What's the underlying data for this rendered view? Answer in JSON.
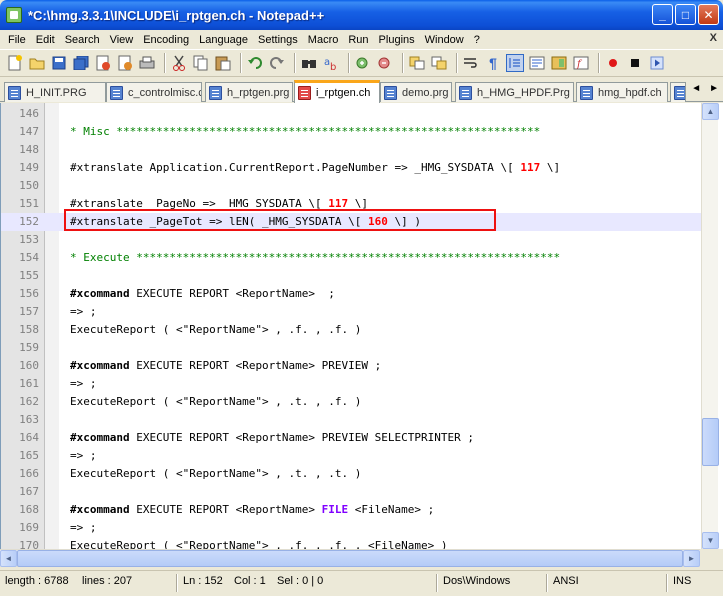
{
  "window": {
    "title": "*C:\\hmg.3.3.1\\INCLUDE\\i_rptgen.ch - Notepad++",
    "minimize_glyph": "_",
    "maximize_glyph": "□",
    "close_glyph": "✕"
  },
  "menu": {
    "items": [
      "File",
      "Edit",
      "Search",
      "View",
      "Encoding",
      "Language",
      "Settings",
      "Macro",
      "Run",
      "Plugins",
      "Window",
      "?"
    ],
    "close_glyph": "X"
  },
  "toolbar": {
    "icons": [
      "new-file-icon",
      "open-file-icon",
      "save-icon",
      "save-all-icon",
      "close-icon",
      "close-all-icon",
      "print-icon",
      "cut-icon",
      "copy-icon",
      "paste-icon",
      "undo-icon",
      "redo-icon",
      "find-icon",
      "replace-icon",
      "zoom-in-icon",
      "zoom-out-icon",
      "sync-v-icon",
      "sync-h-icon",
      "word-wrap-icon",
      "show-all-chars-icon",
      "indent-guide-icon",
      "user-lang-icon",
      "doc-map-icon",
      "function-list-icon",
      "record-macro-icon",
      "stop-macro-icon",
      "play-macro-icon"
    ]
  },
  "tabs": [
    {
      "label": "H_INIT.PRG",
      "active": false,
      "modified": false
    },
    {
      "label": "c_controlmisc.c",
      "active": false,
      "modified": false
    },
    {
      "label": "h_rptgen.prg",
      "active": false,
      "modified": false
    },
    {
      "label": "i_rptgen.ch",
      "active": true,
      "modified": true
    },
    {
      "label": "demo.prg",
      "active": false,
      "modified": false
    },
    {
      "label": "h_HMG_HPDF.Prg",
      "active": false,
      "modified": false
    },
    {
      "label": "hmg_hpdf.ch",
      "active": false,
      "modified": false
    }
  ],
  "tab_arrows": {
    "left": "◄",
    "right": "►"
  },
  "editor": {
    "current_line": 152,
    "lines": [
      {
        "n": "146",
        "segs": []
      },
      {
        "n": "147",
        "segs": [
          {
            "t": "* Misc ****************************************************************",
            "c": "comment"
          }
        ]
      },
      {
        "n": "148",
        "segs": []
      },
      {
        "n": "149",
        "segs": [
          {
            "t": "#xtranslate Application.CurrentReport.PageNumber => _HMG_SYSDATA \\[ ",
            "c": "normal"
          },
          {
            "t": "117",
            "c": "num"
          },
          {
            "t": " \\]",
            "c": "normal"
          }
        ]
      },
      {
        "n": "150",
        "segs": []
      },
      {
        "n": "151",
        "segs": [
          {
            "t": "#xtranslate  PageNo =>  HMG SYSDATA \\[ ",
            "c": "normal"
          },
          {
            "t": "117",
            "c": "num"
          },
          {
            "t": " \\]",
            "c": "normal"
          }
        ]
      },
      {
        "n": "152",
        "segs": [
          {
            "t": "#xtranslate _PageTot => lEN( _HMG_SYSDATA \\[ ",
            "c": "normal"
          },
          {
            "t": "160",
            "c": "num"
          },
          {
            "t": " \\] )",
            "c": "normal"
          }
        ]
      },
      {
        "n": "153",
        "segs": []
      },
      {
        "n": "154",
        "segs": [
          {
            "t": "* Execute ****************************************************************",
            "c": "comment"
          }
        ]
      },
      {
        "n": "155",
        "segs": []
      },
      {
        "n": "156",
        "segs": [
          {
            "t": "#xcommand",
            "c": "kw"
          },
          {
            "t": " EXECUTE REPORT <ReportName>  ;",
            "c": "normal"
          }
        ]
      },
      {
        "n": "157",
        "segs": [
          {
            "t": "=> ;",
            "c": "normal"
          }
        ]
      },
      {
        "n": "158",
        "segs": [
          {
            "t": "ExecuteReport ( <\"ReportName\"> , .f. , .f. )",
            "c": "normal"
          }
        ]
      },
      {
        "n": "159",
        "segs": []
      },
      {
        "n": "160",
        "segs": [
          {
            "t": "#xcommand",
            "c": "kw"
          },
          {
            "t": " EXECUTE REPORT <ReportName> PREVIEW ;",
            "c": "normal"
          }
        ]
      },
      {
        "n": "161",
        "segs": [
          {
            "t": "=> ;",
            "c": "normal"
          }
        ]
      },
      {
        "n": "162",
        "segs": [
          {
            "t": "ExecuteReport ( <\"ReportName\"> , .t. , .f. )",
            "c": "normal"
          }
        ]
      },
      {
        "n": "163",
        "segs": []
      },
      {
        "n": "164",
        "segs": [
          {
            "t": "#xcommand",
            "c": "kw"
          },
          {
            "t": " EXECUTE REPORT <ReportName> PREVIEW SELECTPRINTER ;",
            "c": "normal"
          }
        ]
      },
      {
        "n": "165",
        "segs": [
          {
            "t": "=> ;",
            "c": "normal"
          }
        ]
      },
      {
        "n": "166",
        "segs": [
          {
            "t": "ExecuteReport ( <\"ReportName\"> , .t. , .t. )",
            "c": "normal"
          }
        ]
      },
      {
        "n": "167",
        "segs": []
      },
      {
        "n": "168",
        "segs": [
          {
            "t": "#xcommand",
            "c": "kw"
          },
          {
            "t": " EXECUTE REPORT <ReportName> ",
            "c": "normal"
          },
          {
            "t": "FILE",
            "c": "kw2"
          },
          {
            "t": " <FileName> ;",
            "c": "normal"
          }
        ]
      },
      {
        "n": "169",
        "segs": [
          {
            "t": "=> ;",
            "c": "normal"
          }
        ]
      },
      {
        "n": "170",
        "segs": [
          {
            "t": "ExecuteReport ( <\"ReportName\"> , .f. , .f. , <FileName> )",
            "c": "normal"
          }
        ]
      }
    ]
  },
  "scrollbar": {
    "up": "▲",
    "down": "▼",
    "left": "◄",
    "right": "►",
    "position": 0.82
  },
  "status": {
    "length": "length : 6788",
    "lines": "lines : 207",
    "ln": "Ln : 152",
    "col": "Col : 1",
    "sel": "Sel : 0 | 0",
    "eol": "Dos\\Windows",
    "encoding": "ANSI",
    "mode": "INS"
  },
  "colors": {
    "comment": "#008000",
    "number": "#FF0000",
    "keyword2": "#8000FF",
    "current_line": "#E8E8FF",
    "highlight_box": "#EE1111",
    "active_tab_accent": "#FAA61A"
  }
}
